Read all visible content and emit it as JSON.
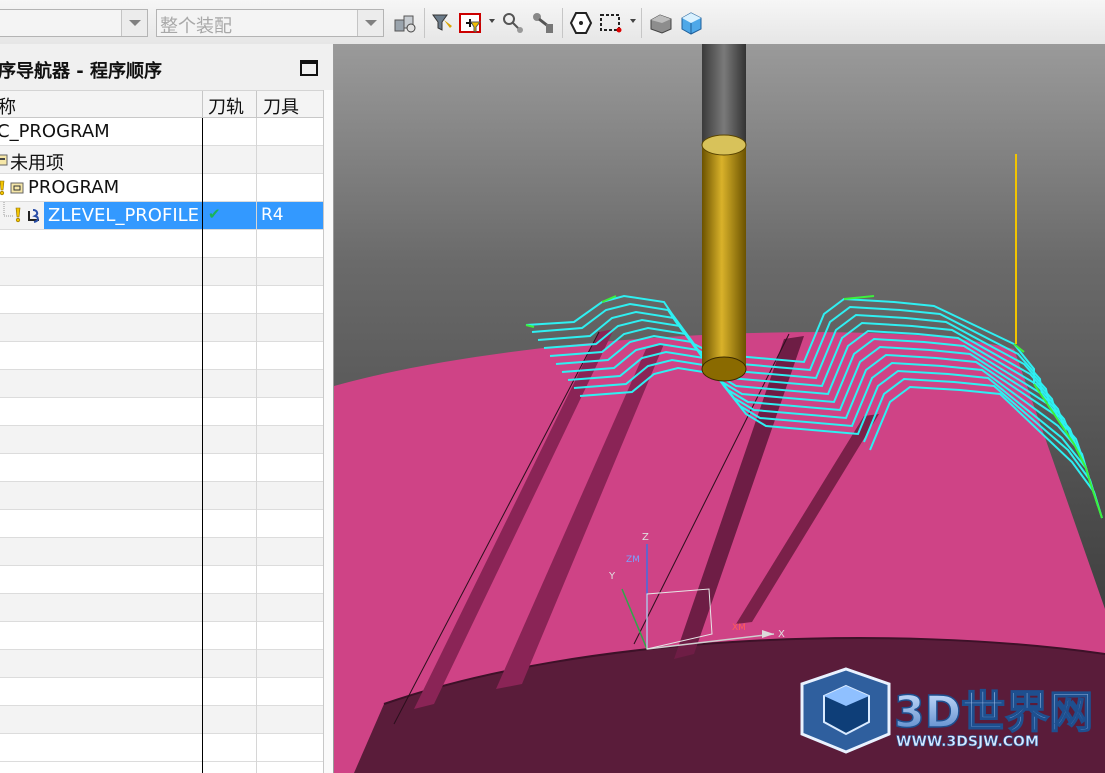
{
  "toolbar": {
    "combo1_value": "",
    "combo2_value": "整个装配",
    "icons": [
      "assembly-icon",
      "filter-icon",
      "select-filter-icon",
      "snap-icon",
      "snap-point-icon",
      "polygon-icon",
      "rectangle-select-icon",
      "shaded-box-icon",
      "view-cube-icon"
    ]
  },
  "navigator": {
    "title": "序导航器 - 程序顺序",
    "columns": {
      "name": "称",
      "toolpath": "刀轨",
      "tool": "刀具"
    },
    "rows": [
      {
        "name": "C_PROGRAM",
        "toolpath": "",
        "tool": ""
      },
      {
        "name": "未用项",
        "toolpath": "",
        "tool": ""
      },
      {
        "name": "PROGRAM",
        "toolpath": "",
        "tool": ""
      },
      {
        "name": "ZLEVEL_PROFILE",
        "toolpath": "✔",
        "tool": "R4"
      }
    ]
  },
  "viewport": {
    "axes": {
      "z": "Z",
      "zm": "ZM",
      "y": "Y",
      "x": "X",
      "xm": "XM"
    },
    "watermark": {
      "brand": "3D世界网",
      "url": "WWW.3DSJW.COM"
    }
  },
  "colors": {
    "part_face": "#cf4386",
    "part_shadow": "#5a1c3a",
    "toolpath_cyan": "#2ef0f2",
    "toolpath_green": "#3cf03c",
    "tool_gold": "#c9a21a",
    "selection": "#3399ff"
  }
}
